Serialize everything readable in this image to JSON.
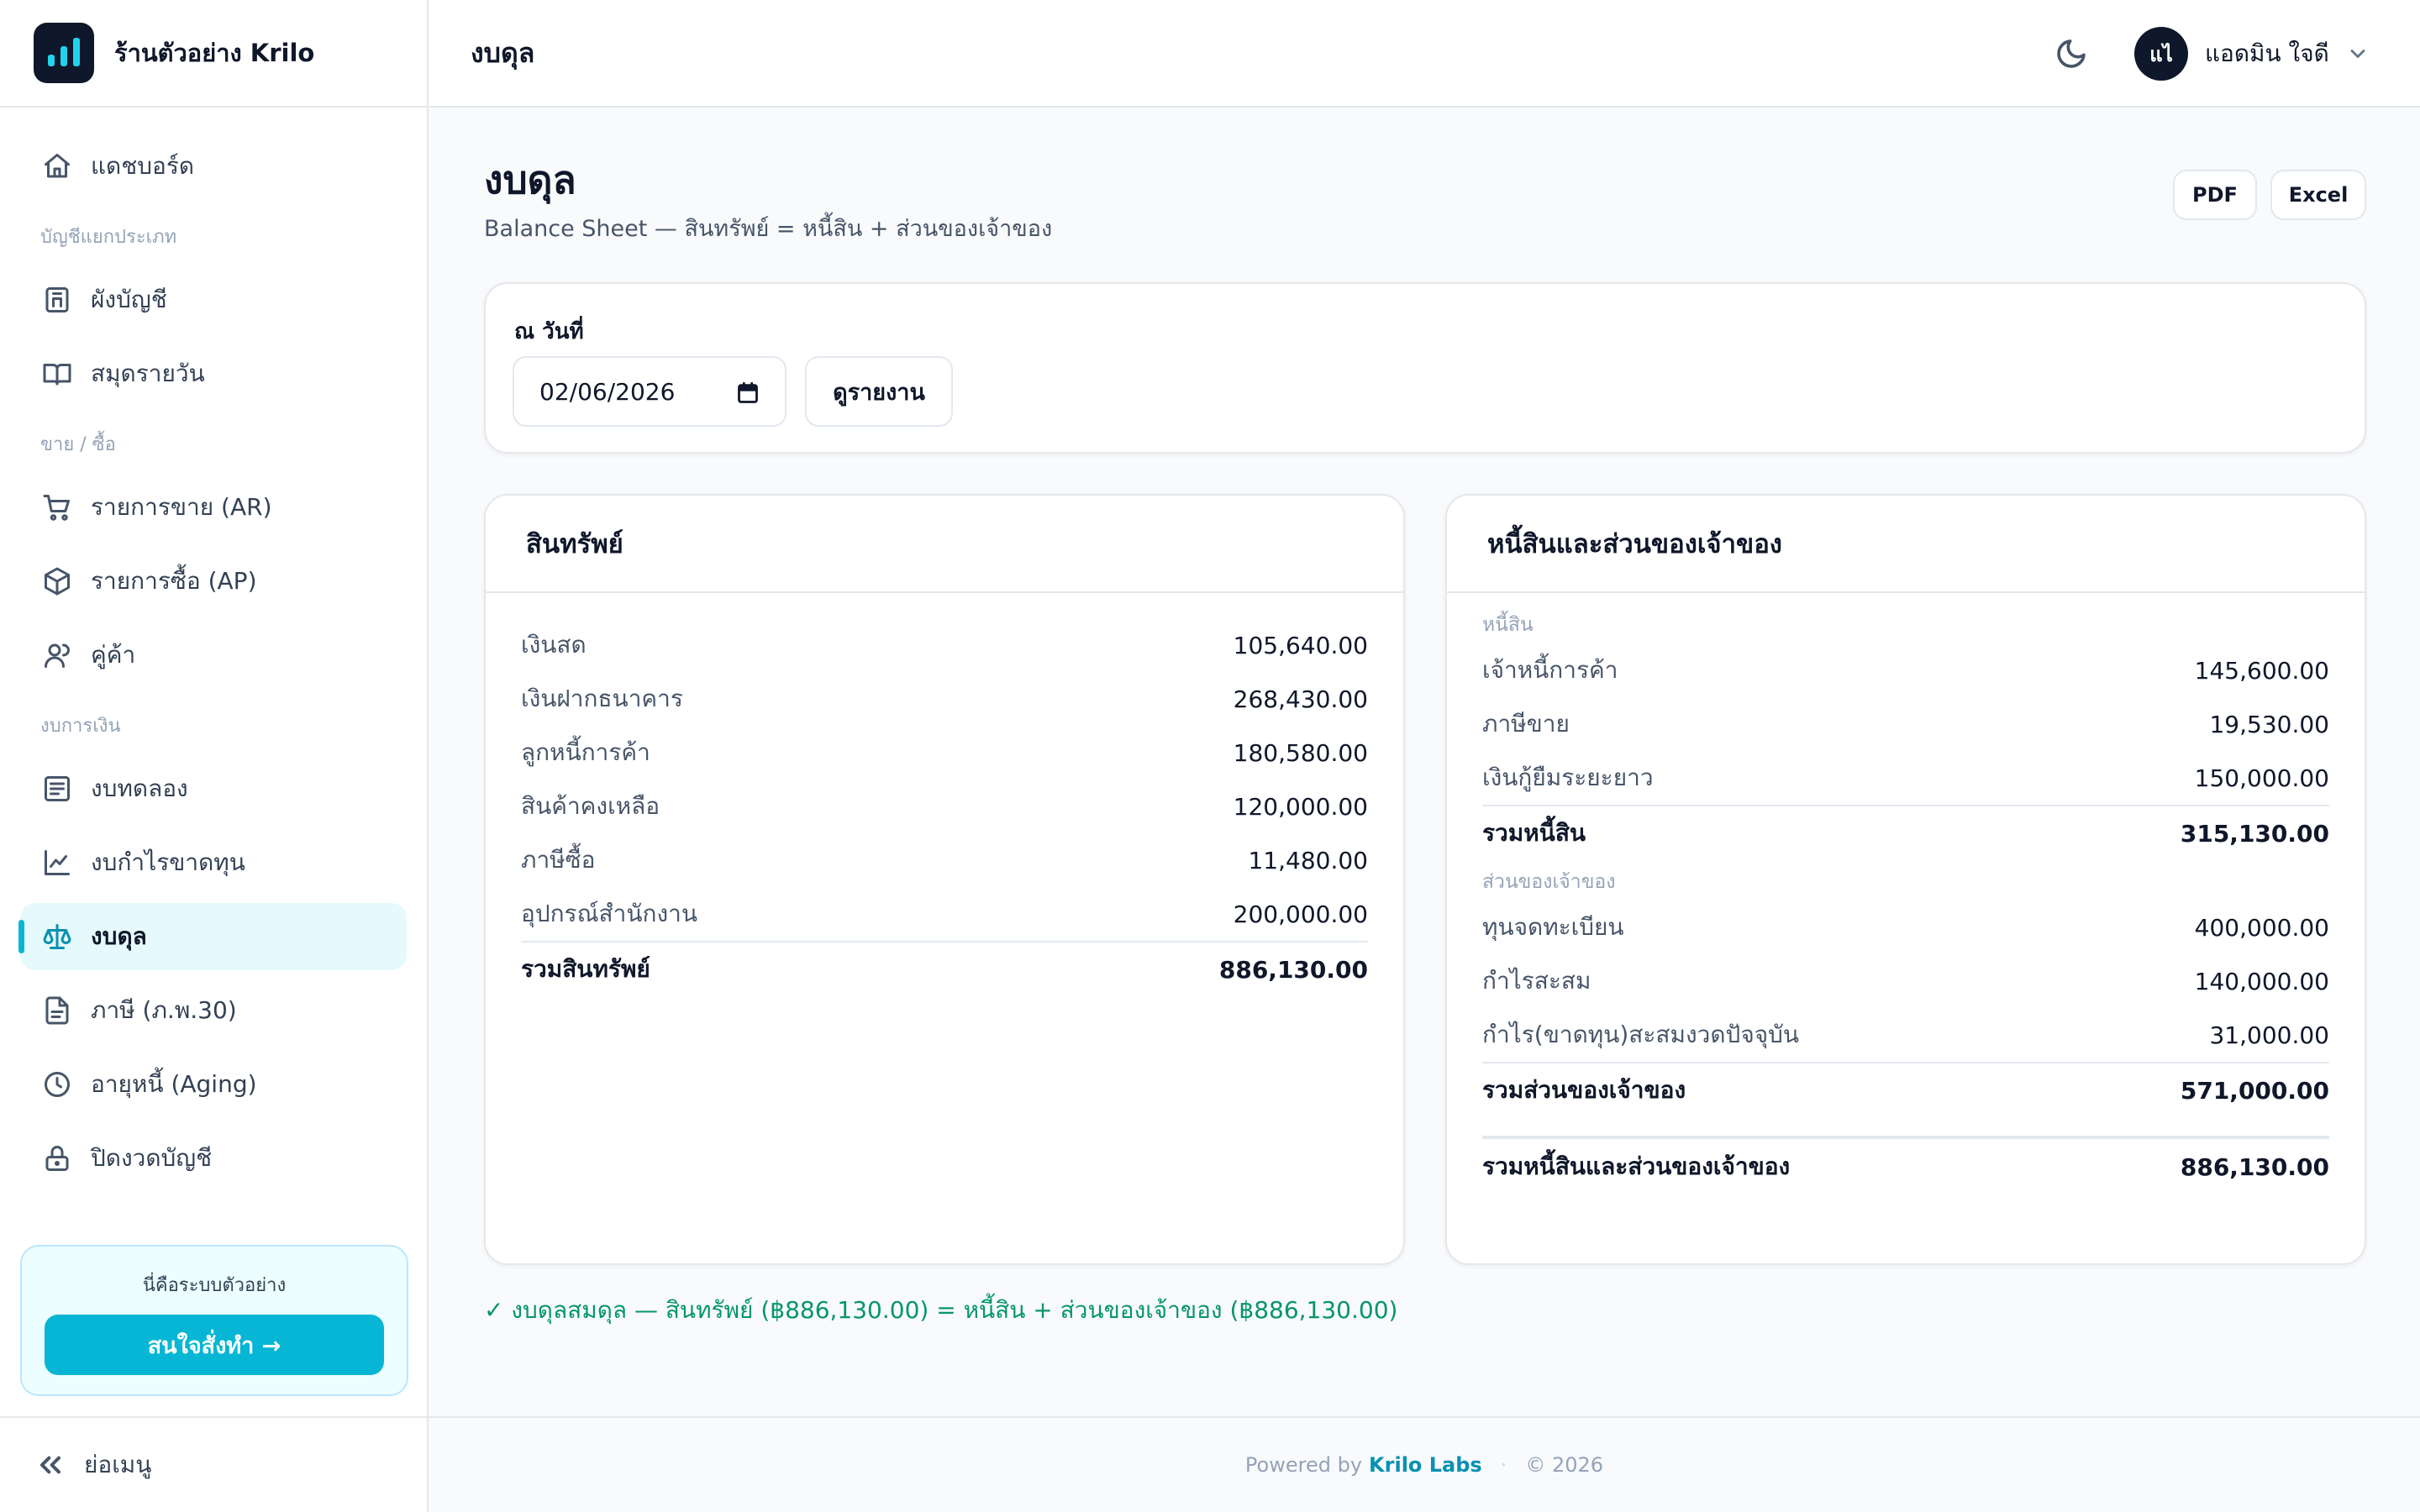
{
  "brand": {
    "name": "ร้านตัวอย่าง Krilo"
  },
  "sidebar": {
    "items": [
      {
        "label": "แดชบอร์ด"
      },
      {
        "section": "บัญชีแยกประเภท"
      },
      {
        "label": "ผังบัญชี"
      },
      {
        "label": "สมุดรายวัน"
      },
      {
        "section": "ขาย / ซื้อ"
      },
      {
        "label": "รายการขาย (AR)"
      },
      {
        "label": "รายการซื้อ (AP)"
      },
      {
        "label": "คู่ค้า"
      },
      {
        "section": "งบการเงิน"
      },
      {
        "label": "งบทดลอง"
      },
      {
        "label": "งบกำไรขาดทุน"
      },
      {
        "label": "งบดุล",
        "active": true
      },
      {
        "label": "ภาษี (ภ.พ.30)"
      },
      {
        "label": "อายุหนี้ (Aging)"
      },
      {
        "label": "ปิดงวดบัญชี"
      }
    ],
    "promo": {
      "text": "นี่คือระบบตัวอย่าง",
      "button": "สนใจสั่งทำ →"
    },
    "collapse_label": "ย่อเมนู"
  },
  "topbar": {
    "title": "งบดุล",
    "user": {
      "initials": "แไ",
      "name": "แอดมิน ใจดี"
    }
  },
  "page": {
    "title": "งบดุล",
    "subtitle": "Balance Sheet — สินทรัพย์ = หนี้สิน + ส่วนของเจ้าของ",
    "export": {
      "pdf": "PDF",
      "excel": "Excel"
    }
  },
  "filter": {
    "label": "ณ วันที่",
    "date_value": "02/06/2026",
    "button": "ดูรายงาน"
  },
  "assets": {
    "title": "สินทรัพย์",
    "rows": [
      {
        "name": "เงินสด",
        "amount": "105,640.00"
      },
      {
        "name": "เงินฝากธนาคาร",
        "amount": "268,430.00"
      },
      {
        "name": "ลูกหนี้การค้า",
        "amount": "180,580.00"
      },
      {
        "name": "สินค้าคงเหลือ",
        "amount": "120,000.00"
      },
      {
        "name": "ภาษีซื้อ",
        "amount": "11,480.00"
      },
      {
        "name": "อุปกรณ์สำนักงาน",
        "amount": "200,000.00"
      }
    ],
    "total": {
      "name": "รวมสินทรัพย์",
      "amount": "886,130.00"
    }
  },
  "liabilities_equity": {
    "title": "หนี้สินและส่วนของเจ้าของ",
    "liabilities_label": "หนี้สิน",
    "liabilities": [
      {
        "name": "เจ้าหนี้การค้า",
        "amount": "145,600.00"
      },
      {
        "name": "ภาษีขาย",
        "amount": "19,530.00"
      },
      {
        "name": "เงินกู้ยืมระยะยาว",
        "amount": "150,000.00"
      }
    ],
    "liabilities_total": {
      "name": "รวมหนี้สิน",
      "amount": "315,130.00"
    },
    "equity_label": "ส่วนของเจ้าของ",
    "equity": [
      {
        "name": "ทุนจดทะเบียน",
        "amount": "400,000.00"
      },
      {
        "name": "กำไรสะสม",
        "amount": "140,000.00"
      },
      {
        "name": "กำไร(ขาดทุน)สะสมงวดปัจจุบัน",
        "amount": "31,000.00"
      }
    ],
    "equity_total": {
      "name": "รวมส่วนของเจ้าของ",
      "amount": "571,000.00"
    },
    "grand_total": {
      "name": "รวมหนี้สินและส่วนของเจ้าของ",
      "amount": "886,130.00"
    }
  },
  "balance_check": "✓ งบดุลสมดุล — สินทรัพย์ (฿886,130.00) = หนี้สิน + ส่วนของเจ้าของ (฿886,130.00)",
  "footer": {
    "powered_by": "Powered by",
    "brand": "Krilo Labs",
    "copyright": "© 2026"
  },
  "colors": {
    "accent": "#06b6d4",
    "brand_dark": "#0f172a",
    "success": "#059669"
  },
  "icons": {
    "sidebar": [
      "home-icon",
      "ledger-icon",
      "book-icon",
      "cart-icon",
      "box-icon",
      "users-icon",
      "list-icon",
      "chart-line-icon",
      "scale-icon",
      "document-icon",
      "clock-icon",
      "lock-icon"
    ],
    "topbar": [
      "moon-icon",
      "chevron-down-icon"
    ]
  }
}
